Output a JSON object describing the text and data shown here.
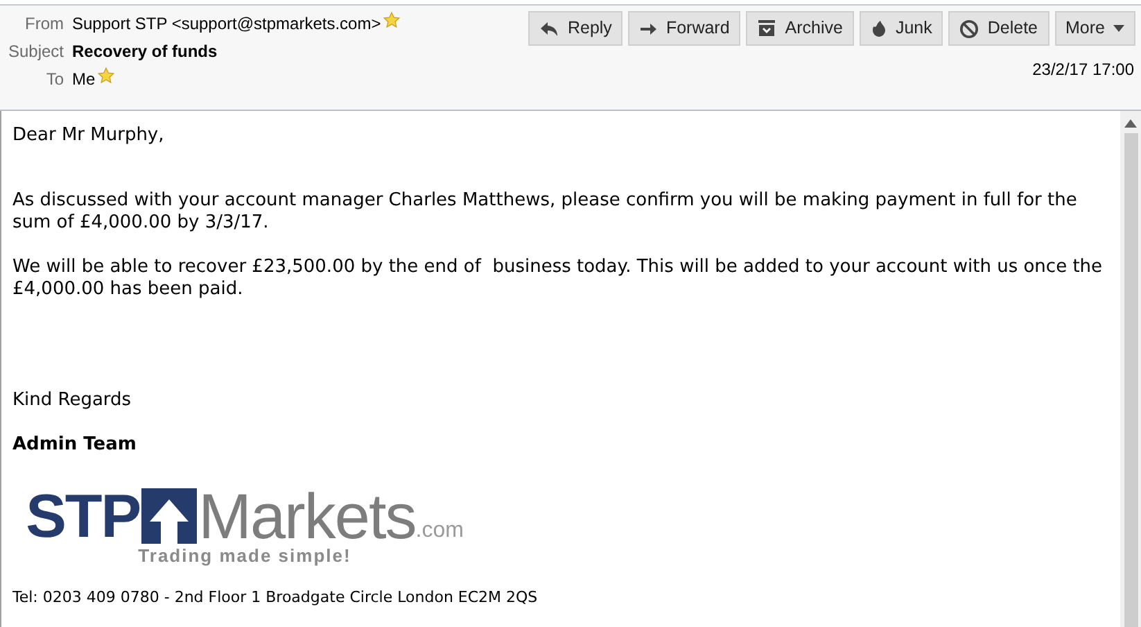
{
  "header": {
    "fields": [
      {
        "label": "From",
        "value": "Support STP <support@stpmarkets.com>",
        "starred": true,
        "bold": false
      },
      {
        "label": "Subject",
        "value": "Recovery of funds",
        "starred": false,
        "bold": true
      },
      {
        "label": "To",
        "value": "Me",
        "starred": true,
        "bold": false
      }
    ],
    "buttons": [
      {
        "kind": "reply",
        "label": "Reply"
      },
      {
        "kind": "forward",
        "label": "Forward"
      },
      {
        "kind": "archive",
        "label": "Archive"
      },
      {
        "kind": "junk",
        "label": "Junk"
      },
      {
        "kind": "delete",
        "label": "Delete"
      },
      {
        "kind": "more",
        "label": "More"
      }
    ],
    "date": "23/2/17 17:00"
  },
  "body": {
    "greeting": "Dear Mr Murphy,",
    "paragraphs": [
      "As discussed with your account manager Charles Matthews, please confirm you will be making payment in full for the sum of £4,000.00 by 3/3/17.",
      "We will be able to recover £23,500.00 by the end of  business today. This will be added to your account with us once the £4,000.00 has been paid."
    ],
    "closing": "Kind Regards",
    "signature": "Admin Team",
    "logo": {
      "left": "STP",
      "right": "Markets",
      "suffix": ".com",
      "tagline": "Trading made simple!"
    },
    "footer": "Tel: 0203 409 0780 - 2nd Floor 1 Broadgate Circle London EC2M 2QS"
  }
}
